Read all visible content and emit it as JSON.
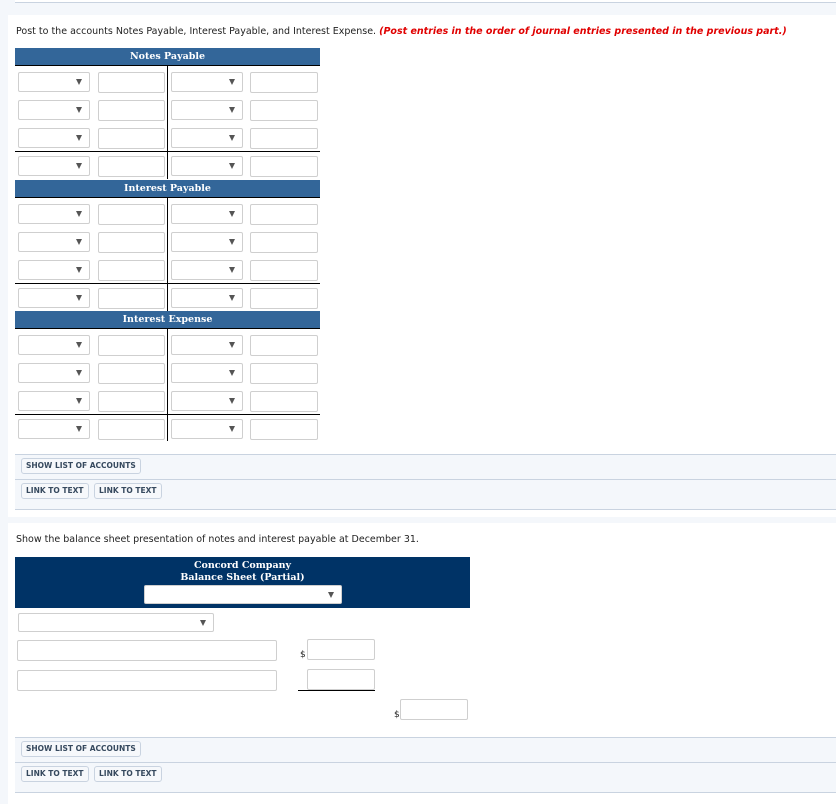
{
  "instructions": {
    "main": "Post to the accounts Notes Payable, Interest Payable, and Interest Expense.",
    "note": "(Post entries in the order of journal entries presented in the previous part.)"
  },
  "t_accounts": [
    {
      "title": "Notes Payable"
    },
    {
      "title": "Interest Payable"
    },
    {
      "title": "Interest Expense"
    }
  ],
  "buttons": {
    "show_list": "SHOW LIST OF ACCOUNTS",
    "link_to_text": "LINK TO TEXT"
  },
  "balance_sheet": {
    "prompt": "Show the balance sheet presentation of notes and interest payable at December 31.",
    "company": "Concord Company",
    "statement": "Balance Sheet (Partial)",
    "currency_symbol": "$"
  }
}
